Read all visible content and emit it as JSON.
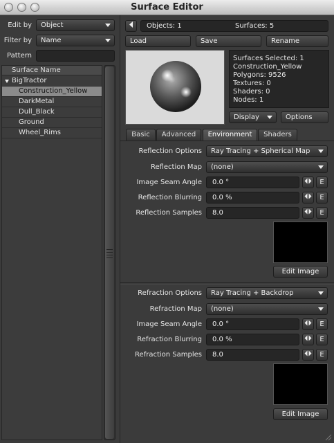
{
  "window": {
    "title": "Surface Editor"
  },
  "left": {
    "edit_by_label": "Edit by",
    "edit_by_value": "Object",
    "filter_by_label": "Filter by",
    "filter_by_value": "Name",
    "pattern_label": "Pattern",
    "pattern_value": "",
    "list_header": "Surface Name",
    "root_item": "BigTractor",
    "items": [
      "Construction_Yellow",
      "DarkMetal",
      "Dull_Black",
      "Ground",
      "Wheel_Rims"
    ]
  },
  "top": {
    "objects": "Objects: 1",
    "surfaces": "Surfaces: 5",
    "load": "Load",
    "save": "Save",
    "rename": "Rename"
  },
  "info": {
    "lines": [
      "Surfaces Selected: 1",
      "Construction_Yellow",
      "Polygons: 9526",
      "Textures: 0",
      "Shaders: 0",
      "Nodes: 1"
    ]
  },
  "preview_buttons": {
    "display": "Display",
    "options": "Options"
  },
  "tabs": [
    "Basic",
    "Advanced",
    "Environment",
    "Shaders"
  ],
  "reflection": {
    "options_label": "Reflection Options",
    "options_value": "Ray Tracing + Spherical Map",
    "map_label": "Reflection Map",
    "map_value": "(none)",
    "seam_label": "Image Seam Angle",
    "seam_value": "0.0 °",
    "blur_label": "Reflection Blurring",
    "blur_value": "0.0 %",
    "samples_label": "Reflection Samples",
    "samples_value": "8.0",
    "edit_image": "Edit Image"
  },
  "refraction": {
    "options_label": "Refraction Options",
    "options_value": "Ray Tracing + Backdrop",
    "map_label": "Refraction Map",
    "map_value": "(none)",
    "seam_label": "Image Seam Angle",
    "seam_value": "0.0 °",
    "blur_label": "Refraction Blurring",
    "blur_value": "0.0 %",
    "samples_label": "Refraction Samples",
    "samples_value": "8.0",
    "edit_image": "Edit Image"
  },
  "envelope_button": "E"
}
